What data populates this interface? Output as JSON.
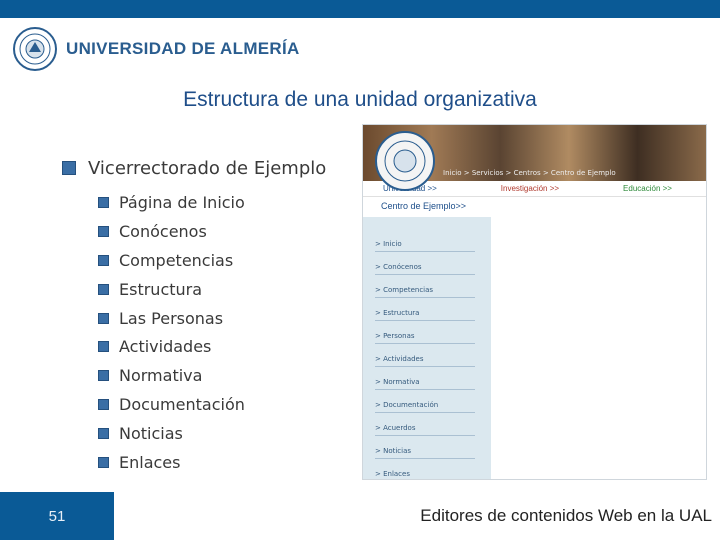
{
  "header": {
    "university": "UNIVERSIDAD DE ALMERÍA"
  },
  "slide": {
    "title": "Estructura de una unidad organizativa",
    "main_bullet": "Vicerrectorado de Ejemplo",
    "sub_bullets": [
      "Página de Inicio",
      "Conócenos",
      "Competencias",
      "Estructura",
      "Las Personas",
      "Actividades",
      "Normativa",
      "Documentación",
      "Noticias",
      "Enlaces"
    ]
  },
  "screenshot": {
    "breadcrumb": "Inicio > Servicios > Centros > Centro de Ejemplo",
    "menu": [
      "Universidad >>",
      "Investigación >>",
      "Educación >>"
    ],
    "section_title": "Centro de Ejemplo>>",
    "side_items": [
      "> Inicio",
      "> Conócenos",
      "> Competencias",
      "> Estructura",
      "> Personas",
      "> Actividades",
      "> Normativa",
      "> Documentación",
      "> Acuerdos",
      "> Noticias",
      "> Enlaces"
    ]
  },
  "footer": {
    "page_number": "51",
    "text": "Editores de contenidos Web en la UAL"
  },
  "colors": {
    "brand_blue": "#0a5a96",
    "title_blue": "#1f4e89"
  }
}
